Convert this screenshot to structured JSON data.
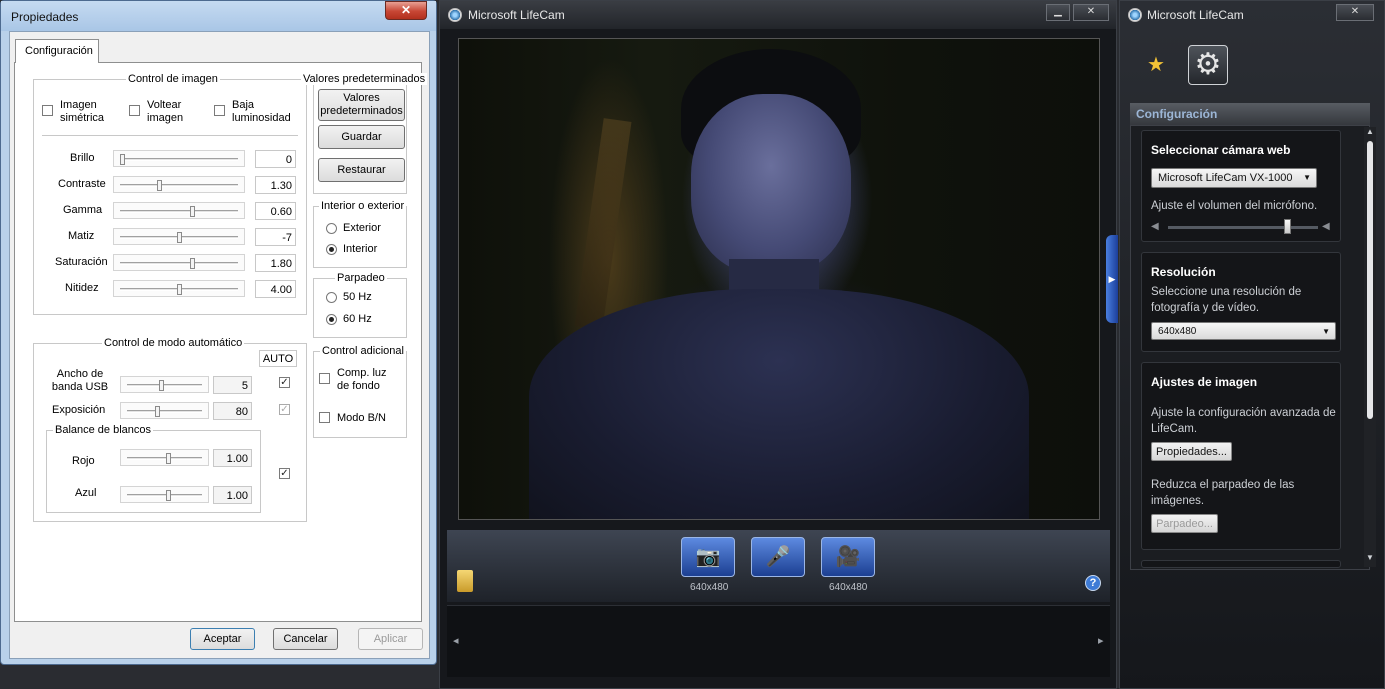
{
  "props": {
    "title": "Propiedades",
    "close_glyph": "✕",
    "tab": "Configuración",
    "image_control": {
      "label": "Control de imagen",
      "checks": [
        {
          "label": "Imagen simétrica",
          "checked": false
        },
        {
          "label": "Voltear imagen",
          "checked": false
        },
        {
          "label": "Baja luminosidad",
          "checked": false
        }
      ],
      "sliders": [
        {
          "label": "Brillo",
          "value": "0",
          "position": 0.0
        },
        {
          "label": "Contraste",
          "value": "1.30",
          "position": 0.33
        },
        {
          "label": "Gamma",
          "value": "0.60",
          "position": 0.62
        },
        {
          "label": "Matiz",
          "value": "-7",
          "position": 0.5
        },
        {
          "label": "Saturación",
          "value": "1.80",
          "position": 0.62
        },
        {
          "label": "Nitidez",
          "value": "4.00",
          "position": 0.5
        }
      ]
    },
    "defaults": {
      "label": "Valores predeterminados",
      "btn_defaults": "Valores predeterminados",
      "btn_save": "Guardar",
      "btn_restore": "Restaurar"
    },
    "indoor_outdoor": {
      "label": "Interior o exterior",
      "options": [
        "Exterior",
        "Interior"
      ],
      "selected": "Interior"
    },
    "flicker": {
      "label": "Parpadeo",
      "options": [
        "50 Hz",
        "60 Hz"
      ],
      "selected": "60 Hz"
    },
    "auto_control": {
      "label": "Control de modo automático",
      "auto_label": "AUTO",
      "rows": [
        {
          "label": "Ancho de banda USB",
          "value": "5",
          "auto": true,
          "position": 0.45
        },
        {
          "label": "Exposición",
          "value": "80",
          "auto": true,
          "position": 0.4
        }
      ],
      "white_balance": {
        "label": "Balance de blancos",
        "rows": [
          {
            "label": "Rojo",
            "value": "1.00",
            "position": 0.55
          },
          {
            "label": "Azul",
            "value": "1.00",
            "position": 0.55
          }
        ],
        "auto": true
      }
    },
    "extra_control": {
      "label": "Control adicional",
      "checks": [
        {
          "label": "Comp. luz de fondo",
          "checked": false
        },
        {
          "label": "Modo B/N",
          "checked": false
        }
      ]
    },
    "buttons": {
      "accept": "Aceptar",
      "cancel": "Cancelar",
      "apply": "Aplicar"
    },
    "check_glyph": "✓"
  },
  "cam": {
    "title": "Microsoft LifeCam",
    "window_buttons": [
      "▁",
      "✕"
    ],
    "tools": [
      {
        "icon": "camera-icon",
        "glyph": "📷",
        "res": "640x480"
      },
      {
        "icon": "microphone-icon",
        "glyph": "🎤",
        "res": ""
      },
      {
        "icon": "video-camera-icon",
        "glyph": "🎥",
        "res": "640x480"
      }
    ],
    "help_glyph": "?",
    "prev_glyph": "◂",
    "next_glyph": "▸"
  },
  "settings": {
    "title": "Microsoft LifeCam",
    "close_glyph": "✕",
    "header": "Configuración",
    "webcam": {
      "title": "Seleccionar cámara web",
      "selected": "Microsoft LifeCam VX-1000",
      "volume_label": "Ajuste el volumen del micrófono.",
      "volume_level": 0.8
    },
    "resolution": {
      "title": "Resolución",
      "desc": "Seleccione una resolución de fotografía y de vídeo.",
      "selected": "640x480"
    },
    "image_settings": {
      "title": "Ajustes de imagen",
      "desc": "Ajuste la configuración avanzada de LifeCam.",
      "btn_props": "Propiedades...",
      "flicker_desc": "Reduzca el parpadeo de las imágenes.",
      "btn_flicker": "Parpadeo..."
    }
  }
}
